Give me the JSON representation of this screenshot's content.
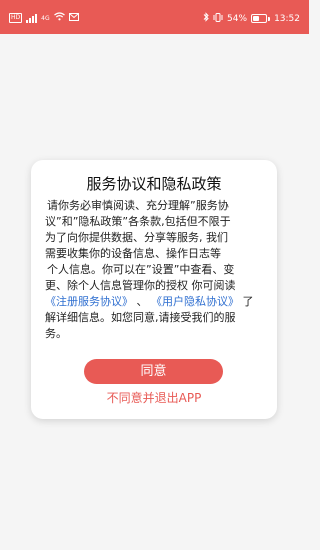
{
  "status_bar": {
    "left_hd_badge": "HD",
    "left_network_badge": "4G",
    "right_battery_percent": "54%",
    "right_time": "13:52",
    "battery_level": 0.54,
    "icons": [
      "hd-icon",
      "signal-icon",
      "wifi-icon",
      "mail-icon",
      "bluetooth-icon",
      "vibrate-icon",
      "battery-icon"
    ],
    "color": "#e85a55"
  },
  "dialog": {
    "title": "服务协议和隐私政策",
    "body": {
      "line1": "请你务必审慎阅读、充分理解”服务协",
      "line2": "议”和”隐私政策”各条款,包括但不限于",
      "line3": "为了向你提供数据、分享等服务, 我们",
      "line4": "需要收集你的设备信息、操作日志等",
      "line5": "个人信息。你可以在”设置”中查看、变",
      "line6": "更、除个人信息管理你的授权 你可阅读",
      "link_register": "《注册服务协议》",
      "separator": "、",
      "link_privacy": "《用户隐私协议》",
      "after_links": "了",
      "line8": "解详细信息。如您同意,请接受我们的服",
      "line9": "务。"
    },
    "agree_label": "同意",
    "decline_label": "不同意并退出APP",
    "accent_color": "#e85a55",
    "link_color": "#2f6fd0"
  }
}
